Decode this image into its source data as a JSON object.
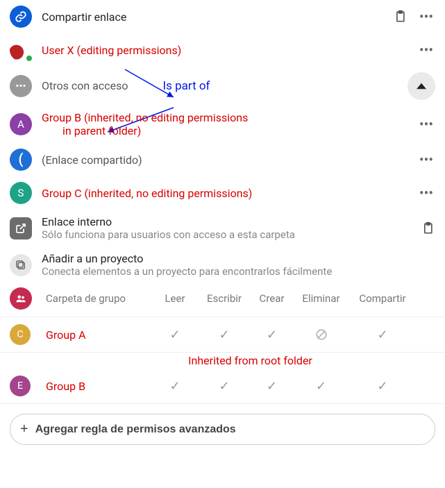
{
  "share_link_label": "Compartir enlace",
  "user_x_label": "User X (editing permissions)",
  "others_label": "Otros con acceso",
  "is_part_of_label": "Is part of",
  "group_b_row": {
    "letter": "A",
    "line1": "Group B (inherited, no editing permissions",
    "line2": "in parent folder)"
  },
  "shared_link_row": {
    "letter": "(",
    "label": "(Enlace compartido)"
  },
  "group_c_row": {
    "letter": "S",
    "label": "Group C (inherited, no editing permissions)"
  },
  "internal_link": {
    "title": "Enlace interno",
    "sub": "Sólo funciona para usuarios con acceso a esta carpeta"
  },
  "add_project": {
    "title": "Añadir a un proyecto",
    "sub": "Conecta elementos a un proyecto para encontrarlos fácilmente"
  },
  "perm_table": {
    "group_folder_label": "Carpeta de grupo",
    "cols": [
      "Leer",
      "Escribir",
      "Crear",
      "Eliminar",
      "Compartir"
    ],
    "rows": [
      {
        "letter": "C",
        "name": "Group A",
        "perms": [
          "y",
          "y",
          "y",
          "n",
          "y"
        ]
      },
      {
        "letter": "E",
        "name": "Group B",
        "perms": [
          "y",
          "y",
          "y",
          "y",
          "y"
        ]
      }
    ],
    "inherited_note": "Inherited from root folder"
  },
  "add_rule_label": "Agregar regla de permisos avanzados"
}
